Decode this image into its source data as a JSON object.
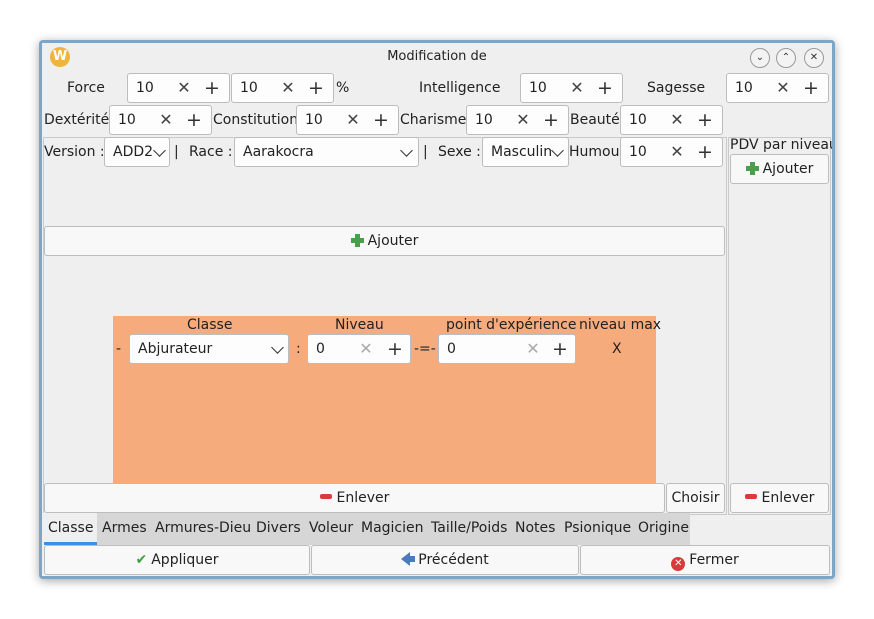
{
  "window": {
    "title": "Modification de",
    "app_logo": "W"
  },
  "stats": {
    "force": {
      "label": "Force",
      "value1": "10",
      "value2": "10",
      "suffix": "%"
    },
    "intelligence": {
      "label": "Intelligence",
      "value": "10"
    },
    "sagesse": {
      "label": "Sagesse",
      "value": "10"
    },
    "dexterite": {
      "label": "Dextérité",
      "value": "10"
    },
    "constitution": {
      "label": "Constitution",
      "value": "10"
    },
    "charisme": {
      "label": "Charisme",
      "value": "10"
    },
    "beaute": {
      "label": "Beauté",
      "value": "10"
    },
    "humour": {
      "label": "Humour",
      "value": "10"
    }
  },
  "row3": {
    "version_label": "Version :",
    "version_value": "ADD2",
    "sep": "|",
    "race_label": "Race :",
    "race_value": "Aarakocra",
    "sexe_label": "Sexe :",
    "sexe_value": "Masculin"
  },
  "pdv": {
    "label": "PDV par niveau",
    "add": "Ajouter",
    "remove": "Enlever"
  },
  "main": {
    "add": "Ajouter",
    "headers": {
      "classe": "Classe",
      "niveau": "Niveau",
      "xp": "point d'expérience",
      "max": "niveau max"
    },
    "row": {
      "dash": "-",
      "classe": "Abjurateur",
      "colon": ":",
      "niveau": "0",
      "eq": "-=-",
      "xp": "0",
      "max": "X"
    },
    "remove": "Enlever",
    "choose": "Choisir"
  },
  "tabs": [
    "Classe",
    "Armes",
    "Armures-Dieu",
    "Divers",
    "Voleur",
    "Magicien",
    "Taille/Poids",
    "Notes",
    "Psionique",
    "Origine"
  ],
  "footer": {
    "apply": "Appliquer",
    "previous": "Précédent",
    "close": "Fermer"
  }
}
